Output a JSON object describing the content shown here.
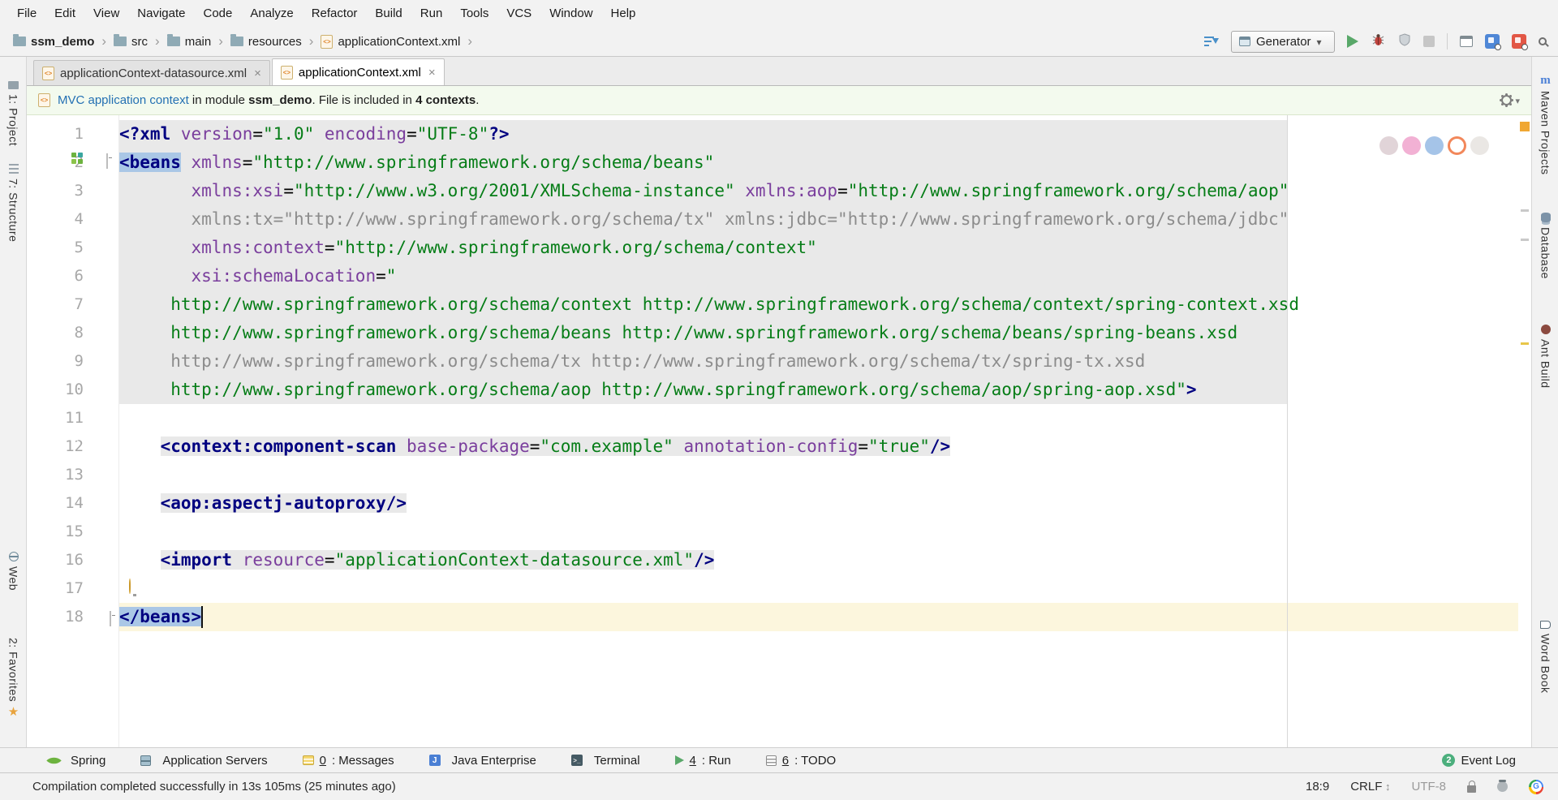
{
  "menu": {
    "items": [
      "File",
      "Edit",
      "View",
      "Navigate",
      "Code",
      "Analyze",
      "Refactor",
      "Build",
      "Run",
      "Tools",
      "VCS",
      "Window",
      "Help"
    ]
  },
  "toolbar": {
    "breadcrumbs": [
      {
        "label": "ssm_demo"
      },
      {
        "label": "src"
      },
      {
        "label": "main"
      },
      {
        "label": "resources"
      },
      {
        "label": "applicationContext.xml"
      }
    ],
    "run_config": {
      "label": "Generator"
    }
  },
  "tabs": {
    "items": [
      {
        "label": "applicationContext-datasource.xml",
        "active": false
      },
      {
        "label": "applicationContext.xml",
        "active": true
      }
    ]
  },
  "notification": {
    "link": "MVC application context",
    "before_module": " in module ",
    "module": "ssm_demo",
    "between": ". File is included in ",
    "contexts": "4 contexts",
    "after": "."
  },
  "editor": {
    "caret": "18:9",
    "lines": [
      {
        "n": 1,
        "indent": 0,
        "bg": "block",
        "segs": [
          [
            "tag",
            "<?xml "
          ],
          [
            "attr",
            "version"
          ],
          [
            "plain",
            "="
          ],
          [
            "val",
            "\"1.0\""
          ],
          [
            "plain",
            " "
          ],
          [
            "attr",
            "encoding"
          ],
          [
            "plain",
            "="
          ],
          [
            "val",
            "\"UTF-8\""
          ],
          [
            "tag",
            "?>"
          ]
        ]
      },
      {
        "n": 2,
        "indent": 0,
        "bg": "block",
        "segs": [
          [
            "taghl",
            "<beans"
          ],
          [
            "plain",
            " "
          ],
          [
            "attr",
            "xmlns"
          ],
          [
            "plain",
            "="
          ],
          [
            "val",
            "\"http://www.springframework.org/schema/beans\""
          ]
        ]
      },
      {
        "n": 3,
        "indent": 7,
        "bg": "block",
        "segs": [
          [
            "attr",
            "xmlns:xsi"
          ],
          [
            "plain",
            "="
          ],
          [
            "val",
            "\"http://www.w3.org/2001/XMLSchema-instance\""
          ],
          [
            "plain",
            " "
          ],
          [
            "attr",
            "xmlns:aop"
          ],
          [
            "plain",
            "="
          ],
          [
            "val",
            "\"http://www.springframework.org/schema/aop\""
          ]
        ]
      },
      {
        "n": 4,
        "indent": 7,
        "bg": "block",
        "segs": [
          [
            "gray",
            "xmlns:tx=\"http://www.springframework.org/schema/tx\" xmlns:jdbc=\"http://www.springframework.org/schema/jdbc\""
          ]
        ]
      },
      {
        "n": 5,
        "indent": 7,
        "bg": "block",
        "segs": [
          [
            "attr",
            "xmlns:context"
          ],
          [
            "plain",
            "="
          ],
          [
            "val",
            "\"http://www.springframework.org/schema/context\""
          ]
        ]
      },
      {
        "n": 6,
        "indent": 7,
        "bg": "block",
        "segs": [
          [
            "attr",
            "xsi:schemaLocation"
          ],
          [
            "plain",
            "="
          ],
          [
            "val",
            "\""
          ]
        ]
      },
      {
        "n": 7,
        "indent": 5,
        "bg": "block",
        "segs": [
          [
            "val",
            "http://www.springframework.org/schema/context http://www.springframework.org/schema/context/spring-context.xsd"
          ]
        ]
      },
      {
        "n": 8,
        "indent": 5,
        "bg": "block",
        "segs": [
          [
            "val",
            "http://www.springframework.org/schema/beans http://www.springframework.org/schema/beans/spring-beans.xsd"
          ]
        ]
      },
      {
        "n": 9,
        "indent": 5,
        "bg": "block",
        "segs": [
          [
            "gray",
            "http://www.springframework.org/schema/tx http://www.springframework.org/schema/tx/spring-tx.xsd"
          ]
        ]
      },
      {
        "n": 10,
        "indent": 5,
        "bg": "block",
        "segs": [
          [
            "val",
            "http://www.springframework.org/schema/aop http://www.springframework.org/schema/aop/spring-aop.xsd\""
          ],
          [
            "tag",
            ">"
          ]
        ]
      },
      {
        "n": 11,
        "indent": 0,
        "bg": "none",
        "segs": []
      },
      {
        "n": 12,
        "indent": 4,
        "bg": "inline",
        "segs": [
          [
            "tag",
            "<context:component-scan"
          ],
          [
            "plain",
            " "
          ],
          [
            "attr",
            "base-package"
          ],
          [
            "plain",
            "="
          ],
          [
            "val",
            "\"com.example\""
          ],
          [
            "plain",
            " "
          ],
          [
            "attr",
            "annotation-config"
          ],
          [
            "plain",
            "="
          ],
          [
            "val",
            "\"true\""
          ],
          [
            "tag",
            "/>"
          ]
        ]
      },
      {
        "n": 13,
        "indent": 0,
        "bg": "none",
        "segs": []
      },
      {
        "n": 14,
        "indent": 4,
        "bg": "inline",
        "segs": [
          [
            "tag",
            "<aop:aspectj-autoproxy/>"
          ]
        ]
      },
      {
        "n": 15,
        "indent": 0,
        "bg": "none",
        "segs": []
      },
      {
        "n": 16,
        "indent": 4,
        "bg": "inline",
        "segs": [
          [
            "tag",
            "<import"
          ],
          [
            "plain",
            " "
          ],
          [
            "attr",
            "resource"
          ],
          [
            "plain",
            "="
          ],
          [
            "val",
            "\"applicationContext-datasource.xml\""
          ],
          [
            "tag",
            "/>"
          ]
        ]
      },
      {
        "n": 17,
        "indent": 0,
        "bg": "none",
        "segs": []
      },
      {
        "n": 18,
        "indent": 0,
        "bg": "current",
        "segs": [
          [
            "taghl",
            "</beans>"
          ]
        ]
      }
    ]
  },
  "left_stripe": {
    "top": [
      {
        "label": "1: Project"
      },
      {
        "label": "7: Structure"
      }
    ],
    "bottom": [
      {
        "label": "Web"
      },
      {
        "label": "2: Favorites"
      }
    ]
  },
  "right_stripe": {
    "items": [
      {
        "label": "Maven Projects"
      },
      {
        "label": "Database"
      },
      {
        "label": "Ant Build"
      },
      {
        "label": "Word Book"
      }
    ]
  },
  "bottom_bar": {
    "items": [
      {
        "num": "",
        "label": "Spring"
      },
      {
        "num": "",
        "label": "Application Servers"
      },
      {
        "num": "0",
        "label": ": Messages"
      },
      {
        "num": "",
        "label": "Java Enterprise"
      },
      {
        "num": "",
        "label": "Terminal"
      },
      {
        "num": "4",
        "label": ": Run"
      },
      {
        "num": "6",
        "label": ": TODO"
      }
    ],
    "event_log": {
      "badge": "2",
      "label": "Event Log"
    }
  },
  "status_bar": {
    "message": "Compilation completed successfully in 13s 105ms (25 minutes ago)",
    "caret": "18:9",
    "line_ending": "CRLF",
    "encoding": "UTF-8"
  },
  "colors": {
    "tag": "#000080",
    "attribute": "#7a3e9d",
    "value": "#067d17",
    "unused_gray": "#8c8c8c",
    "matched_tag_bg": "#aac7e6",
    "current_line_bg": "#fcf6dd",
    "fragment_bg": "#e9e9e9",
    "notification_bg": "#f3faee",
    "link": "#2470b3",
    "run_green": "#59a869",
    "warning_stripe": "#f0a732",
    "overlay_dots": [
      "#d9c9ce",
      "#ef9ec9",
      "#8fb5e2",
      "#ffffff",
      "#d5d0ca"
    ]
  }
}
